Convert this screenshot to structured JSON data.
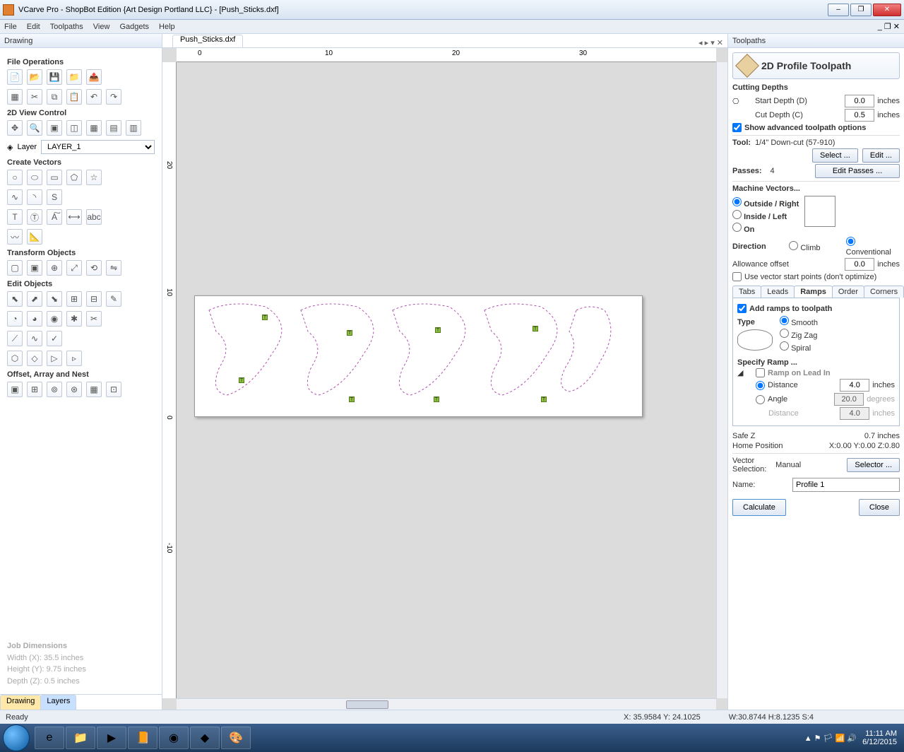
{
  "window": {
    "title": "VCarve Pro - ShopBot Edition {Art Design Portland LLC} - [Push_Sticks.dxf]"
  },
  "menu": {
    "items": [
      "File",
      "Edit",
      "Toolpaths",
      "View",
      "Gadgets",
      "Help"
    ]
  },
  "left": {
    "header": "Drawing",
    "sections": {
      "file_ops": "File Operations",
      "view_ctrl": "2D View Control",
      "layer_label": "Layer",
      "layer_value": "LAYER_1",
      "create_vec": "Create Vectors",
      "transform": "Transform Objects",
      "edit_obj": "Edit Objects",
      "offset": "Offset, Array and Nest"
    },
    "job": {
      "title": "Job Dimensions",
      "width": "Width  (X): 35.5 inches",
      "height": "Height (Y): 9.75 inches",
      "depth": "Depth  (Z): 0.5 inches"
    },
    "tabs": {
      "drawing": "Drawing",
      "layers": "Layers"
    }
  },
  "doc": {
    "tab": "Push_Sticks.dxf"
  },
  "ruler": {
    "ticks": [
      "0",
      "10",
      "20",
      "30"
    ],
    "vticks": [
      "20",
      "10",
      "0",
      "-10"
    ]
  },
  "right": {
    "header": "Toolpaths",
    "title": "2D Profile Toolpath",
    "cutting": {
      "label": "Cutting Depths",
      "start_label": "Start Depth (D)",
      "start_val": "0.0",
      "start_unit": "inches",
      "cut_label": "Cut Depth (C)",
      "cut_val": "0.5",
      "cut_unit": "inches",
      "adv_label": "Show advanced toolpath options"
    },
    "tool": {
      "label": "Tool:",
      "name": "1/4\"  Down-cut (57-910)",
      "select": "Select ...",
      "edit": "Edit ...",
      "passes_label": "Passes:",
      "passes_val": "4",
      "edit_passes": "Edit Passes ..."
    },
    "mv": {
      "label": "Machine Vectors...",
      "outside": "Outside / Right",
      "inside": "Inside / Left",
      "on": "On",
      "dir_label": "Direction",
      "climb": "Climb",
      "conv": "Conventional",
      "allow_label": "Allowance offset",
      "allow_val": "0.0",
      "allow_unit": "inches",
      "startpts": "Use vector start points (don't optimize)"
    },
    "tabs": {
      "tabs": "Tabs",
      "leads": "Leads",
      "ramps": "Ramps",
      "order": "Order",
      "corners": "Corners"
    },
    "ramps": {
      "add": "Add ramps to toolpath",
      "type": "Type",
      "smooth": "Smooth",
      "zigzag": "Zig Zag",
      "spiral": "Spiral",
      "specify": "Specify Ramp ...",
      "leadin": "Ramp on Lead In",
      "dist_label": "Distance",
      "dist_val": "4.0",
      "dist_unit": "inches",
      "angle_label": "Angle",
      "angle_val": "20.0",
      "angle_unit": "degrees",
      "dist2_label": "Distance",
      "dist2_val": "4.0",
      "dist2_unit": "inches"
    },
    "safez": {
      "label": "Safe Z",
      "val": "0.7 inches"
    },
    "home": {
      "label": "Home Position",
      "val": "X:0.00 Y:0.00 Z:0.80"
    },
    "vsel": {
      "label": "Vector Selection:",
      "mode": "Manual",
      "btn": "Selector ..."
    },
    "name": {
      "label": "Name:",
      "val": "Profile 1"
    },
    "calc": "Calculate",
    "close": "Close"
  },
  "status": {
    "ready": "Ready",
    "xy": "X: 35.9584  Y: 24.1025",
    "whs": "W:30.8744   H:8.1235   S:4"
  },
  "taskbar": {
    "time": "11:11 AM",
    "date": "6/12/2015"
  }
}
